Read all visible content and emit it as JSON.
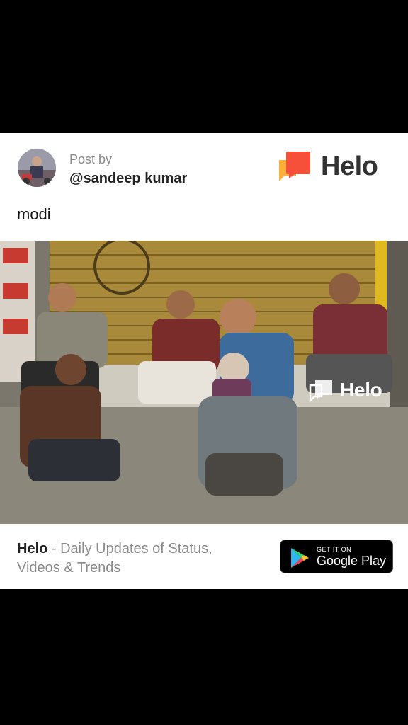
{
  "post": {
    "post_by_label": "Post by",
    "username": "@sandeep kumar",
    "caption": "modi"
  },
  "brand": {
    "name": "Helo",
    "watermark": "Helo",
    "accent_orange": "#f7503a",
    "accent_yellow": "#fcb03b"
  },
  "footer": {
    "brand": "Helo",
    "tagline": " - Daily Updates of Status, Videos & Trends"
  },
  "store_badge": {
    "small_text": "GET IT ON",
    "store_name": "Google Play"
  }
}
